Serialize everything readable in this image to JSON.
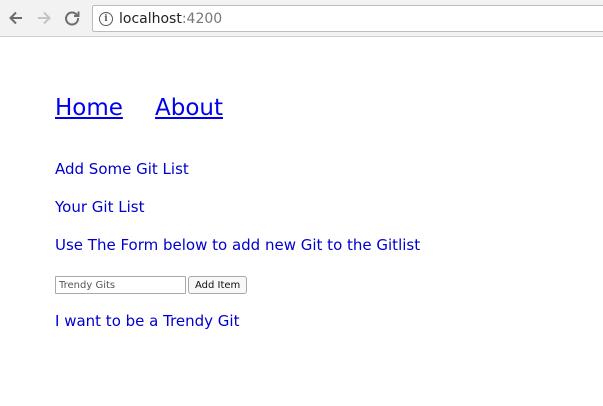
{
  "browser": {
    "url_host": "localhost",
    "url_port": ":4200",
    "info_glyph": "i"
  },
  "nav": {
    "home_label": "Home",
    "about_label": "About"
  },
  "content": {
    "heading_add": "Add Some Git List",
    "heading_list": "Your Git List",
    "instructions": "Use The Form below to add new Git to the Gitlist"
  },
  "form": {
    "input_placeholder": "Trendy Gits",
    "add_button_label": "Add Item"
  },
  "git_list": {
    "items": [
      "I want to be a Trendy Git"
    ]
  },
  "colors": {
    "link": "#0000ee",
    "text": "#0000cd"
  }
}
